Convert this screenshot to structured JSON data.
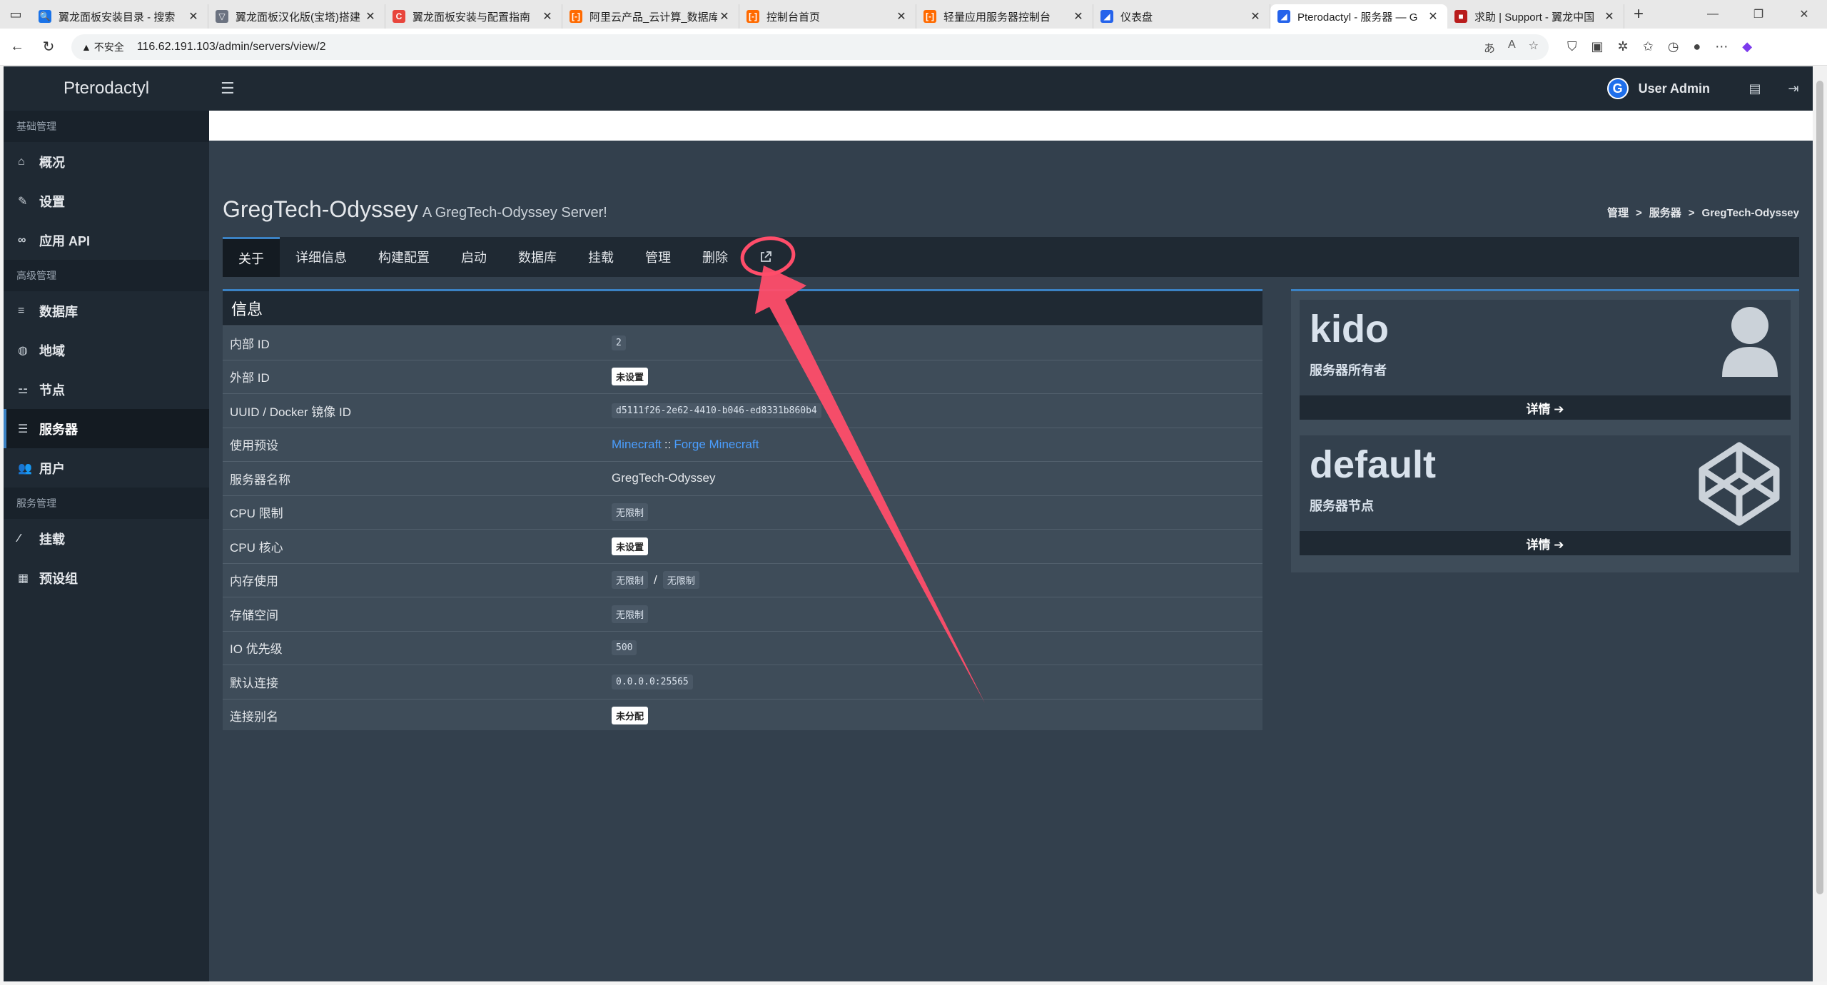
{
  "browser": {
    "tabs": [
      {
        "title": "翼龙面板安装目录 - 搜索",
        "fav_color": "#1a73e8",
        "fav_glyph": "🔍"
      },
      {
        "title": "翼龙面板汉化版(宝塔)搭建",
        "fav_color": "#6b7280",
        "fav_glyph": "▽"
      },
      {
        "title": "翼龙面板安装与配置指南",
        "fav_color": "#e8453c",
        "fav_glyph": "C"
      },
      {
        "title": "阿里云产品_云计算_数据库",
        "fav_color": "#ff6a00",
        "fav_glyph": "[-]"
      },
      {
        "title": "控制台首页",
        "fav_color": "#ff6a00",
        "fav_glyph": "[-]"
      },
      {
        "title": "轻量应用服务器控制台",
        "fav_color": "#ff6a00",
        "fav_glyph": "[-]"
      },
      {
        "title": "仪表盘",
        "fav_color": "#2563eb",
        "fav_glyph": "◢"
      },
      {
        "title": "Pterodactyl - 服务器 — G",
        "fav_color": "#2563eb",
        "fav_glyph": "◢"
      },
      {
        "title": "求助 | Support - 翼龙中国",
        "fav_color": "#b91c1c",
        "fav_glyph": "■"
      }
    ],
    "active_tab_index": 7,
    "insecure_label": "不安全",
    "url": "116.62.191.103/admin/servers/view/2"
  },
  "app": {
    "brand": "Pterodactyl",
    "user_name": "User Admin",
    "user_avatar_letter": "G"
  },
  "sidebar": {
    "sections": [
      {
        "header": "基础管理",
        "items": [
          {
            "label": "概况",
            "icon": "home-icon",
            "glyph": "⌂"
          },
          {
            "label": "设置",
            "icon": "wrench-icon",
            "glyph": "✎"
          },
          {
            "label": "应用 API",
            "icon": "link-icon",
            "glyph": "∞"
          }
        ]
      },
      {
        "header": "高级管理",
        "items": [
          {
            "label": "数据库",
            "icon": "database-icon",
            "glyph": "≡"
          },
          {
            "label": "地域",
            "icon": "globe-icon",
            "glyph": "◍"
          },
          {
            "label": "节点",
            "icon": "sitemap-icon",
            "glyph": "⚍"
          },
          {
            "label": "服务器",
            "icon": "server-icon",
            "glyph": "☰"
          },
          {
            "label": "用户",
            "icon": "users-icon",
            "glyph": "👥"
          }
        ]
      },
      {
        "header": "服务管理",
        "items": [
          {
            "label": "挂载",
            "icon": "magic-icon",
            "glyph": "⁄"
          },
          {
            "label": "预设组",
            "icon": "th-large-icon",
            "glyph": "▦"
          }
        ]
      }
    ]
  },
  "page": {
    "title": "GregTech-Odyssey",
    "subtitle": "A GregTech-Odyssey Server!",
    "breadcrumbs": [
      "管理",
      "服务器",
      "GregTech-Odyssey"
    ]
  },
  "tabs": [
    "关于",
    "详细信息",
    "构建配置",
    "启动",
    "数据库",
    "挂载",
    "管理",
    "删除"
  ],
  "info": {
    "header": "信息",
    "rows": {
      "internal_id": {
        "label": "内部 ID",
        "value": "2"
      },
      "external_id": {
        "label": "外部 ID",
        "value": "未设置"
      },
      "uuid": {
        "label": "UUID / Docker 镜像 ID",
        "value": "d5111f26-2e62-4410-b046-ed8331b860b4"
      },
      "preset": {
        "label": "使用预设",
        "nest": "Minecraft",
        "sep": "::",
        "egg": "Forge Minecraft"
      },
      "server_name": {
        "label": "服务器名称",
        "value": "GregTech-Odyssey"
      },
      "cpu_limit": {
        "label": "CPU 限制",
        "value": "无限制"
      },
      "cpu_cores": {
        "label": "CPU 核心",
        "value": "未设置"
      },
      "memory": {
        "label": "内存使用",
        "value": "无限制",
        "sep": "/",
        "value2": "无限制"
      },
      "disk": {
        "label": "存储空间",
        "value": "无限制"
      },
      "io": {
        "label": "IO 优先级",
        "value": "500"
      },
      "default_conn": {
        "label": "默认连接",
        "value": "0.0.0.0:25565"
      },
      "alias": {
        "label": "连接别名",
        "value": "未分配"
      }
    }
  },
  "owner_card": {
    "name": "kido",
    "caption": "服务器所有者",
    "link": "详情 ➔"
  },
  "node_card": {
    "name": "default",
    "caption": "服务器节点",
    "link": "详情 ➔"
  },
  "colors": {
    "accent": "#3b82c4",
    "annotation": "#ff4d6a",
    "link": "#4a9eff"
  }
}
